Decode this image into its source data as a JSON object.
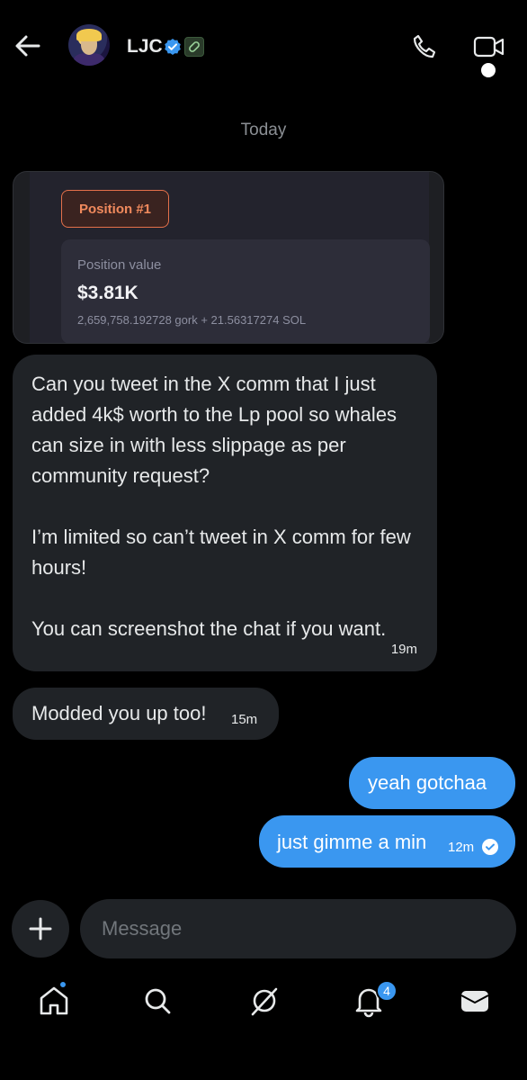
{
  "header": {
    "name": "LJC",
    "back_icon": "arrow-left-icon",
    "verified_icon": "verified-badge-icon",
    "badge_icon": "link-pill-icon",
    "call_icon": "phone-icon",
    "video_icon": "video-camera-icon"
  },
  "date_separator": "Today",
  "position_card": {
    "pill": "Position #1",
    "label": "Position value",
    "amount": "$3.81K",
    "detail": "2,659,758.192728 gork + 21.56317274 SOL"
  },
  "messages": [
    {
      "direction": "incoming",
      "text": "Can you tweet in the X comm that I just added 4k$ worth to the Lp pool so whales can size in with less slippage as per community request?\n\nI’m limited so can’t tweet in X comm for few hours!\n\nYou can screenshot the chat if you want.",
      "time": "19m"
    },
    {
      "direction": "incoming",
      "text": "Modded you up too!",
      "time": "15m"
    },
    {
      "direction": "outgoing",
      "text": "yeah gotchaa"
    },
    {
      "direction": "outgoing",
      "text": "just gimme a min",
      "time": "12m"
    }
  ],
  "composer": {
    "placeholder": "Message",
    "add_icon": "plus-icon"
  },
  "nav": {
    "items": [
      "home-icon",
      "search-icon",
      "grok-icon",
      "bell-icon",
      "mail-icon"
    ],
    "notification_count": "4"
  },
  "colors": {
    "accent": "#3a97f0",
    "incoming_bubble": "#202327",
    "background": "#000000"
  }
}
